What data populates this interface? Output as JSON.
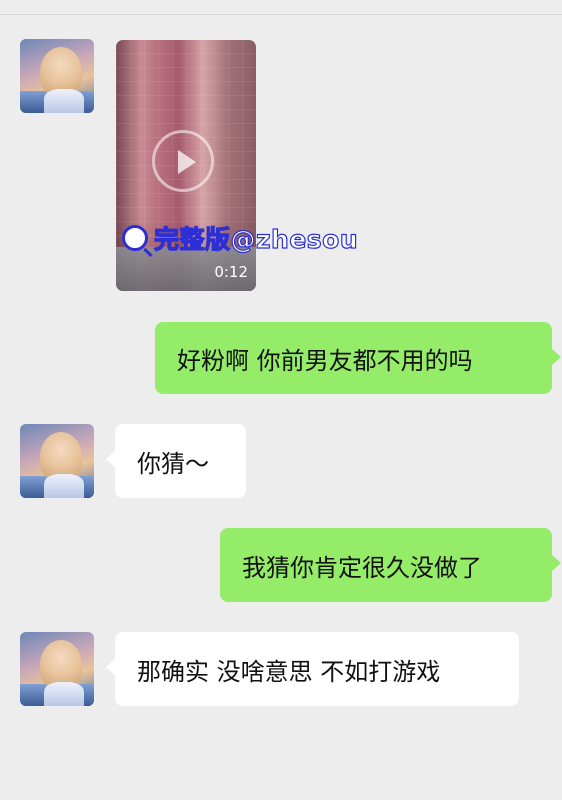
{
  "messages": [
    {
      "from": "them",
      "type": "video",
      "duration": "0:12",
      "watermark": "完整版@zhesou",
      "avatar_icon": "anime-girl-avatar"
    },
    {
      "from": "me",
      "type": "text",
      "text": "好粉啊 你前男友都不用的吗"
    },
    {
      "from": "them",
      "type": "text",
      "text": "你猜～"
    },
    {
      "from": "me",
      "type": "text",
      "text": "我猜你肯定很久没做了"
    },
    {
      "from": "them",
      "type": "text",
      "text": "那确实 没啥意思 不如打游戏"
    }
  ],
  "colors": {
    "background": "#ededed",
    "sent_bubble": "#95ec69",
    "received_bubble": "#ffffff"
  }
}
